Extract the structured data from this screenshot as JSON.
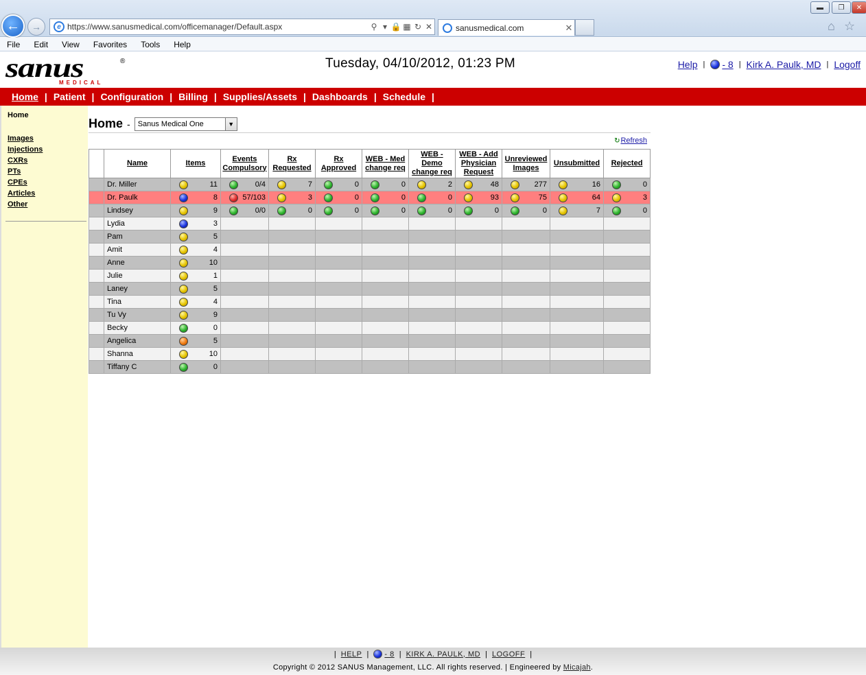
{
  "browser": {
    "url": "https://www.sanusmedical.com/officemanager/Default.aspx",
    "tab_title": "sanusmedical.com",
    "menu": [
      "File",
      "Edit",
      "View",
      "Favorites",
      "Tools",
      "Help"
    ]
  },
  "header": {
    "logo_text": "sanus",
    "logo_sub": "MEDICAL",
    "datetime": "Tuesday, 04/10/2012, 01:23 PM",
    "help_label": "Help",
    "messages_label": "- 8",
    "user_name": "Kirk A. Paulk, MD",
    "logoff_label": "Logoff"
  },
  "nav": [
    "Home",
    "Patient",
    "Configuration",
    "Billing",
    "Supplies/Assets",
    "Dashboards",
    "Schedule"
  ],
  "sidebar": {
    "title": "Home",
    "items": [
      "Images",
      "Injections",
      "CXRs",
      "PTs",
      "CPEs",
      "Articles",
      "Other"
    ]
  },
  "main": {
    "title": "Home",
    "office": "Sanus Medical One",
    "refresh_label": "Refresh"
  },
  "grid": {
    "columns": [
      "Name",
      "Items",
      "Events Compulsory",
      "Rx Requested",
      "Rx Approved",
      "WEB - Med change req",
      "WEB - Demo change req",
      "WEB - Add Physician Request",
      "Unreviewed Images",
      "Unsubmitted",
      "Rejected"
    ],
    "rows": [
      {
        "name": "Dr. Miller",
        "highlight": false,
        "cells": [
          [
            "yellow",
            "11"
          ],
          [
            "green",
            "0/4"
          ],
          [
            "yellow",
            "7"
          ],
          [
            "green",
            "0"
          ],
          [
            "green",
            "0"
          ],
          [
            "yellow",
            "2"
          ],
          [
            "yellow",
            "48"
          ],
          [
            "yellow",
            "277"
          ],
          [
            "yellow",
            "16"
          ],
          [
            "green",
            "0"
          ]
        ]
      },
      {
        "name": "Dr. Paulk",
        "highlight": true,
        "cells": [
          [
            "blue",
            "8"
          ],
          [
            "red",
            "57/103"
          ],
          [
            "yellow",
            "3"
          ],
          [
            "green",
            "0"
          ],
          [
            "green",
            "0"
          ],
          [
            "green",
            "0"
          ],
          [
            "yellow",
            "93"
          ],
          [
            "yellow",
            "75"
          ],
          [
            "yellow",
            "64"
          ],
          [
            "yellow",
            "3"
          ]
        ]
      },
      {
        "name": "Lindsey",
        "highlight": false,
        "cells": [
          [
            "yellow",
            "9"
          ],
          [
            "green",
            "0/0"
          ],
          [
            "green",
            "0"
          ],
          [
            "green",
            "0"
          ],
          [
            "green",
            "0"
          ],
          [
            "green",
            "0"
          ],
          [
            "green",
            "0"
          ],
          [
            "green",
            "0"
          ],
          [
            "yellow",
            "7"
          ],
          [
            "green",
            "0"
          ]
        ]
      },
      {
        "name": "Lydia",
        "highlight": false,
        "cells": [
          [
            "blue",
            "3"
          ]
        ]
      },
      {
        "name": "Pam",
        "highlight": false,
        "cells": [
          [
            "yellow",
            "5"
          ]
        ]
      },
      {
        "name": "Amit",
        "highlight": false,
        "cells": [
          [
            "yellow",
            "4"
          ]
        ]
      },
      {
        "name": "Anne",
        "highlight": false,
        "cells": [
          [
            "yellow",
            "10"
          ]
        ]
      },
      {
        "name": "Julie",
        "highlight": false,
        "cells": [
          [
            "yellow",
            "1"
          ]
        ]
      },
      {
        "name": "Laney",
        "highlight": false,
        "cells": [
          [
            "yellow",
            "5"
          ]
        ]
      },
      {
        "name": "Tina",
        "highlight": false,
        "cells": [
          [
            "yellow",
            "4"
          ]
        ]
      },
      {
        "name": "Tu Vy",
        "highlight": false,
        "cells": [
          [
            "yellow",
            "9"
          ]
        ]
      },
      {
        "name": "Becky",
        "highlight": false,
        "cells": [
          [
            "green",
            "0"
          ]
        ]
      },
      {
        "name": "Angelica",
        "highlight": false,
        "cells": [
          [
            "orange",
            "5"
          ]
        ]
      },
      {
        "name": "Shanna",
        "highlight": false,
        "cells": [
          [
            "yellow",
            "10"
          ]
        ]
      },
      {
        "name": "Tiffany C",
        "highlight": false,
        "cells": [
          [
            "green",
            "0"
          ]
        ]
      }
    ]
  },
  "footer": {
    "help": "HELP",
    "messages": "- 8",
    "user": "KIRK A. PAULK, MD",
    "logoff": "LOGOFF",
    "copyright": "Copyright © 2012 SANUS Management, LLC. All rights reserved. | Engineered by ",
    "engineer": "Micajah",
    "period": "."
  },
  "colors": {
    "nav_bg": "#cc0000",
    "sidebar_bg": "#fdfbd2",
    "alert_row": "#ff7f7f",
    "link": "#1a1aa6"
  }
}
